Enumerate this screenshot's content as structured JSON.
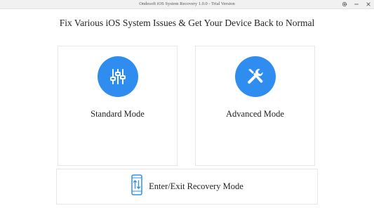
{
  "window": {
    "title": "Ondesoft iOS System Recovery 1.0.0 - Trial Version",
    "controls": [
      "settings-icon",
      "minimize-icon",
      "close-icon"
    ]
  },
  "main": {
    "heading": "Fix Various iOS System Issues & Get Your Device Back to Normal",
    "modes": [
      {
        "label": "Standard Mode",
        "icon": "sliders-icon"
      },
      {
        "label": "Advanced Mode",
        "icon": "tools-icon"
      }
    ],
    "recovery": {
      "label": "Enter/Exit Recovery Mode",
      "icon": "phone-arrows-icon"
    }
  },
  "colors": {
    "accent": "#2f8def",
    "text": "#222222",
    "card_border": "#e6e6e6"
  }
}
